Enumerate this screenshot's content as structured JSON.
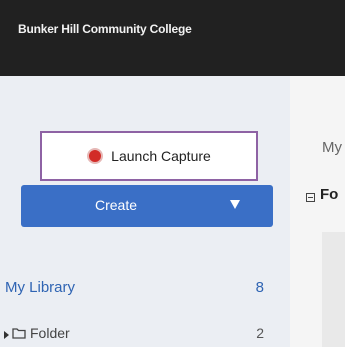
{
  "header": {
    "org_name": "Bunker Hill Community College"
  },
  "sidebar": {
    "launch_capture_label": "Launch Capture",
    "create_label": "Create",
    "library": {
      "label": "My Library",
      "count": "8"
    },
    "folder": {
      "label": "Folder",
      "count": "2"
    }
  },
  "main": {
    "heading_partial": "My",
    "section_partial": "Fo"
  },
  "colors": {
    "topbar_bg": "#212121",
    "sidebar_bg": "#ebeef3",
    "accent_blue": "#3a6fc6",
    "link_blue": "#2f64b3",
    "capture_border": "#8e62a4",
    "record_red": "#d22b27"
  }
}
